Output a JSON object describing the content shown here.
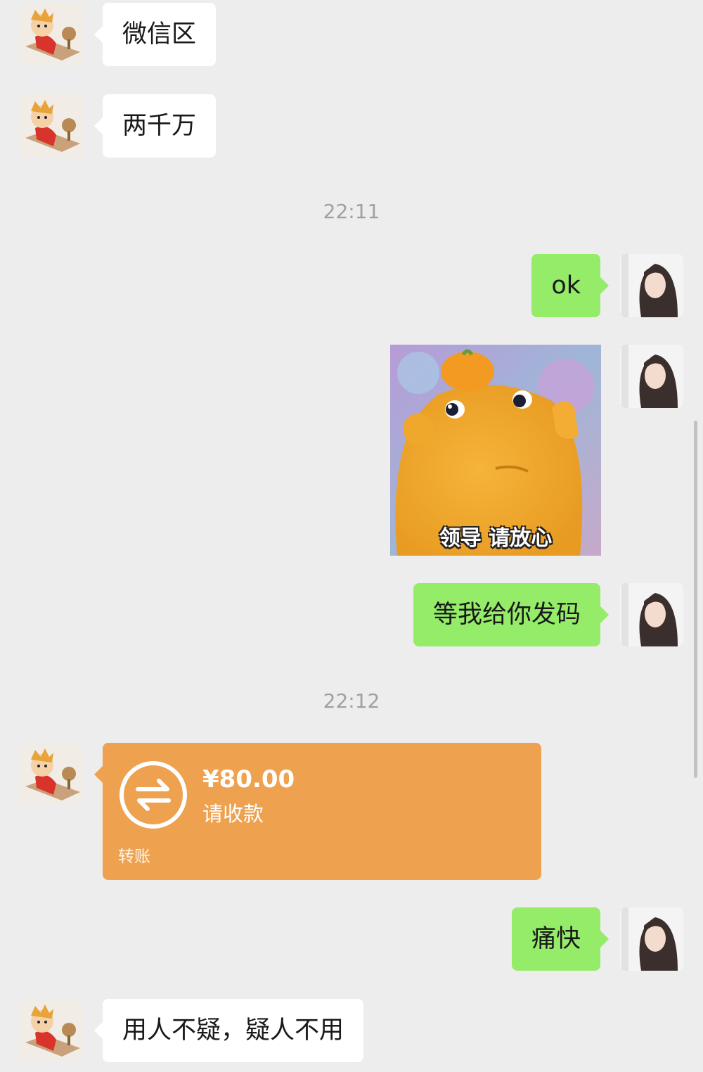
{
  "messages": [
    {
      "side": "in",
      "text": "微信区"
    },
    {
      "side": "in",
      "text": "两千万"
    },
    {
      "time": "22:11"
    },
    {
      "side": "out",
      "text": "ok"
    },
    {
      "side": "out",
      "sticker_caption": "领导 请放心"
    },
    {
      "side": "out",
      "text": "等我给你发码"
    },
    {
      "time": "22:12"
    },
    {
      "side": "in",
      "transfer": {
        "amount": "¥80.00",
        "status": "请收款",
        "footer": "转账"
      }
    },
    {
      "side": "out",
      "text": "痛快"
    },
    {
      "side": "in",
      "text": "用人不疑，疑人不用"
    }
  ],
  "colors": {
    "background": "#ededed",
    "incoming_bubble": "#ffffff",
    "outgoing_bubble": "#95ec69",
    "transfer_card": "#eea24f",
    "timestamp": "#a0a0a0"
  },
  "icons": {
    "transfer": "transfer-arrows-icon"
  }
}
